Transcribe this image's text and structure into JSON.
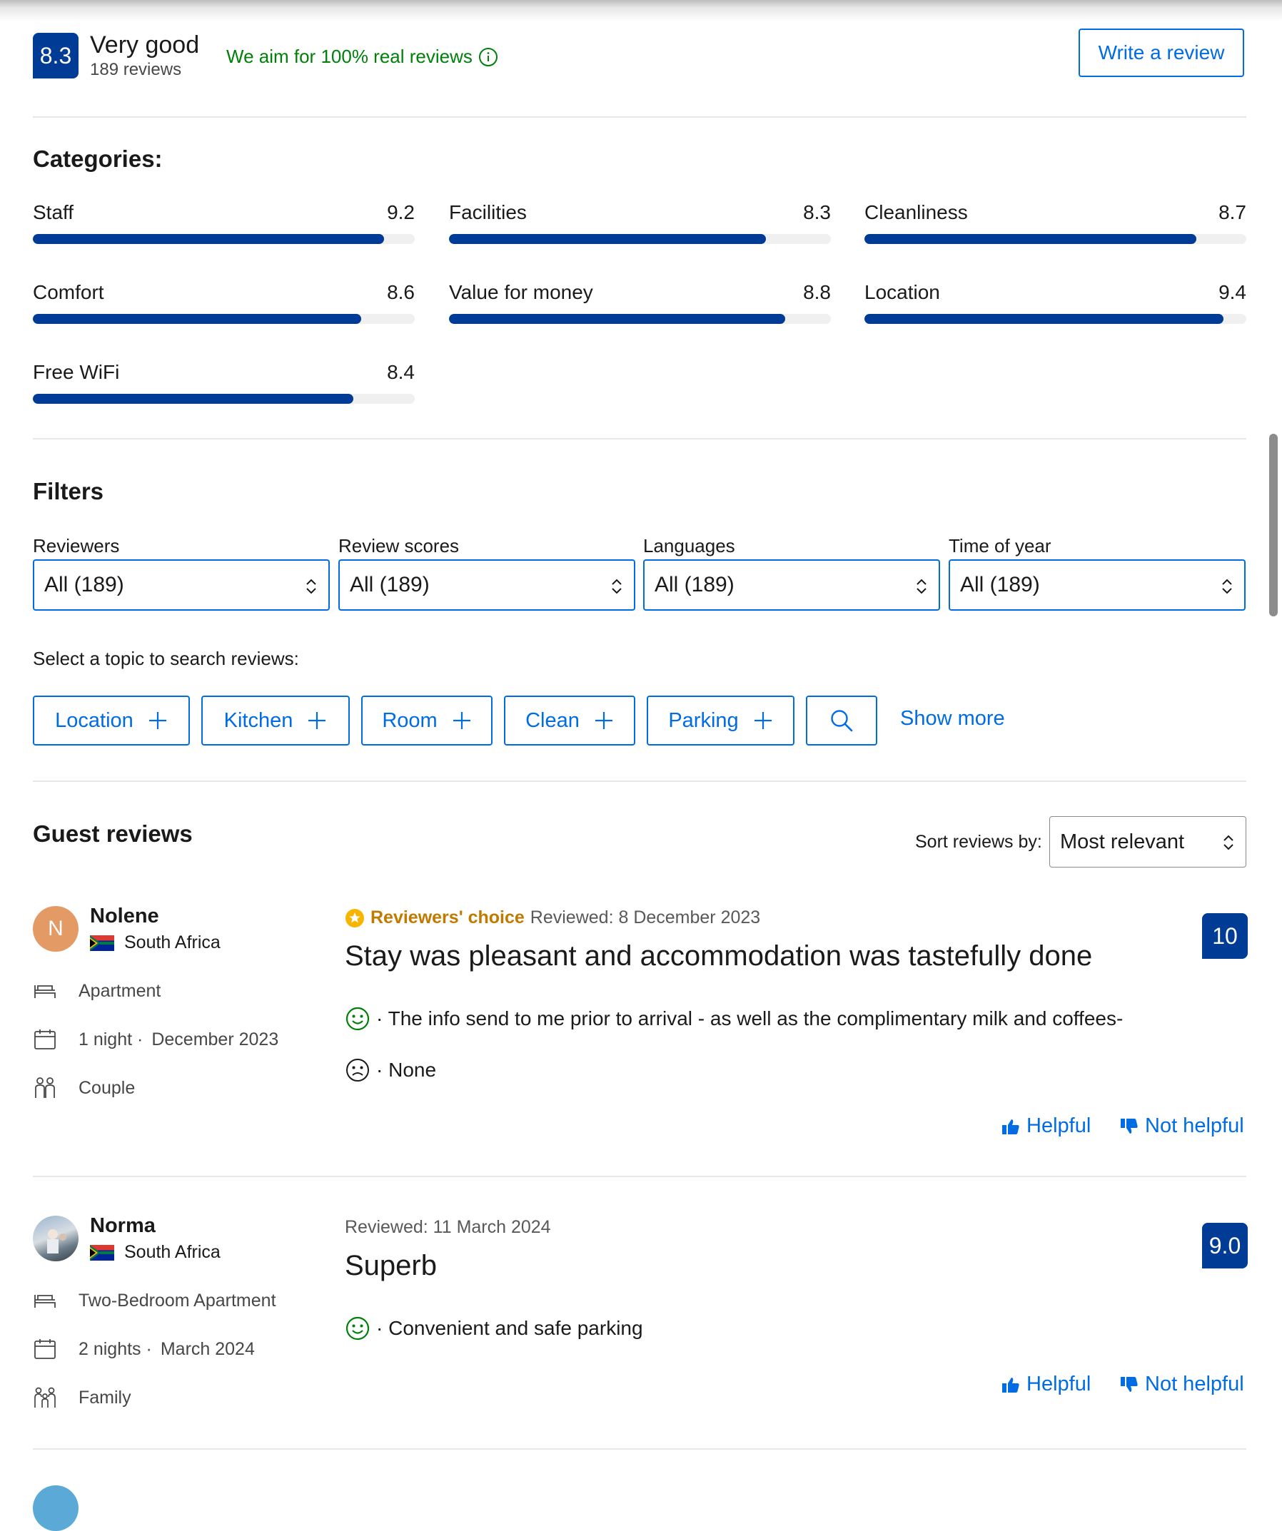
{
  "summary": {
    "score": "8.3",
    "rating_word": "Very good",
    "review_count": "189 reviews",
    "real_reviews_text": "We aim for 100% real reviews",
    "write_review_label": "Write a review"
  },
  "categories": {
    "title": "Categories:",
    "items": [
      {
        "label": "Staff",
        "score": "9.2",
        "fill": 0.92
      },
      {
        "label": "Facilities",
        "score": "8.3",
        "fill": 0.83
      },
      {
        "label": "Cleanliness",
        "score": "8.7",
        "fill": 0.87
      },
      {
        "label": "Comfort",
        "score": "8.6",
        "fill": 0.86
      },
      {
        "label": "Value for money",
        "score": "8.8",
        "fill": 0.88
      },
      {
        "label": "Location",
        "score": "9.4",
        "fill": 0.94
      },
      {
        "label": "Free WiFi",
        "score": "8.4",
        "fill": 0.84
      }
    ]
  },
  "filters": {
    "title": "Filters",
    "selects": [
      {
        "label": "Reviewers",
        "value": "All (189)"
      },
      {
        "label": "Review scores",
        "value": "All (189)"
      },
      {
        "label": "Languages",
        "value": "All (189)"
      },
      {
        "label": "Time of year",
        "value": "All (189)"
      }
    ],
    "topic_prompt": "Select a topic to search reviews:",
    "topics": [
      "Location",
      "Kitchen",
      "Room",
      "Clean",
      "Parking"
    ],
    "show_more_label": "Show more"
  },
  "guest_reviews": {
    "title": "Guest reviews",
    "sort_label": "Sort reviews by:",
    "sort_value": "Most relevant",
    "reviews": [
      {
        "initial": "N",
        "name": "Nolene",
        "country": "South Africa",
        "room": "Apartment",
        "stay": "1 night ·",
        "date": "December 2023",
        "traveler": "Couple",
        "badge": "Reviewers' choice",
        "reviewed": "Reviewed: 8 December 2023",
        "title": "Stay was pleasant and accommodation was tastefully done",
        "liked": "· The info send to me prior to arrival - as well as the complimentary milk and coffees-",
        "disliked": "· None",
        "score": "10",
        "helpful": "Helpful",
        "not_helpful": "Not helpful"
      },
      {
        "name": "Norma",
        "country": "South Africa",
        "room": "Two-Bedroom Apartment",
        "stay": "2 nights ·",
        "date": "March 2024",
        "traveler": "Family",
        "reviewed": "Reviewed: 11 March 2024",
        "title": "Superb",
        "liked": "· Convenient and safe parking",
        "score": "9.0",
        "helpful": "Helpful",
        "not_helpful": "Not helpful"
      }
    ]
  },
  "colors": {
    "brand_blue": "#003b95",
    "link_blue": "#006ce4",
    "positive_green": "#008009",
    "choice_gold": "#c07a00"
  }
}
